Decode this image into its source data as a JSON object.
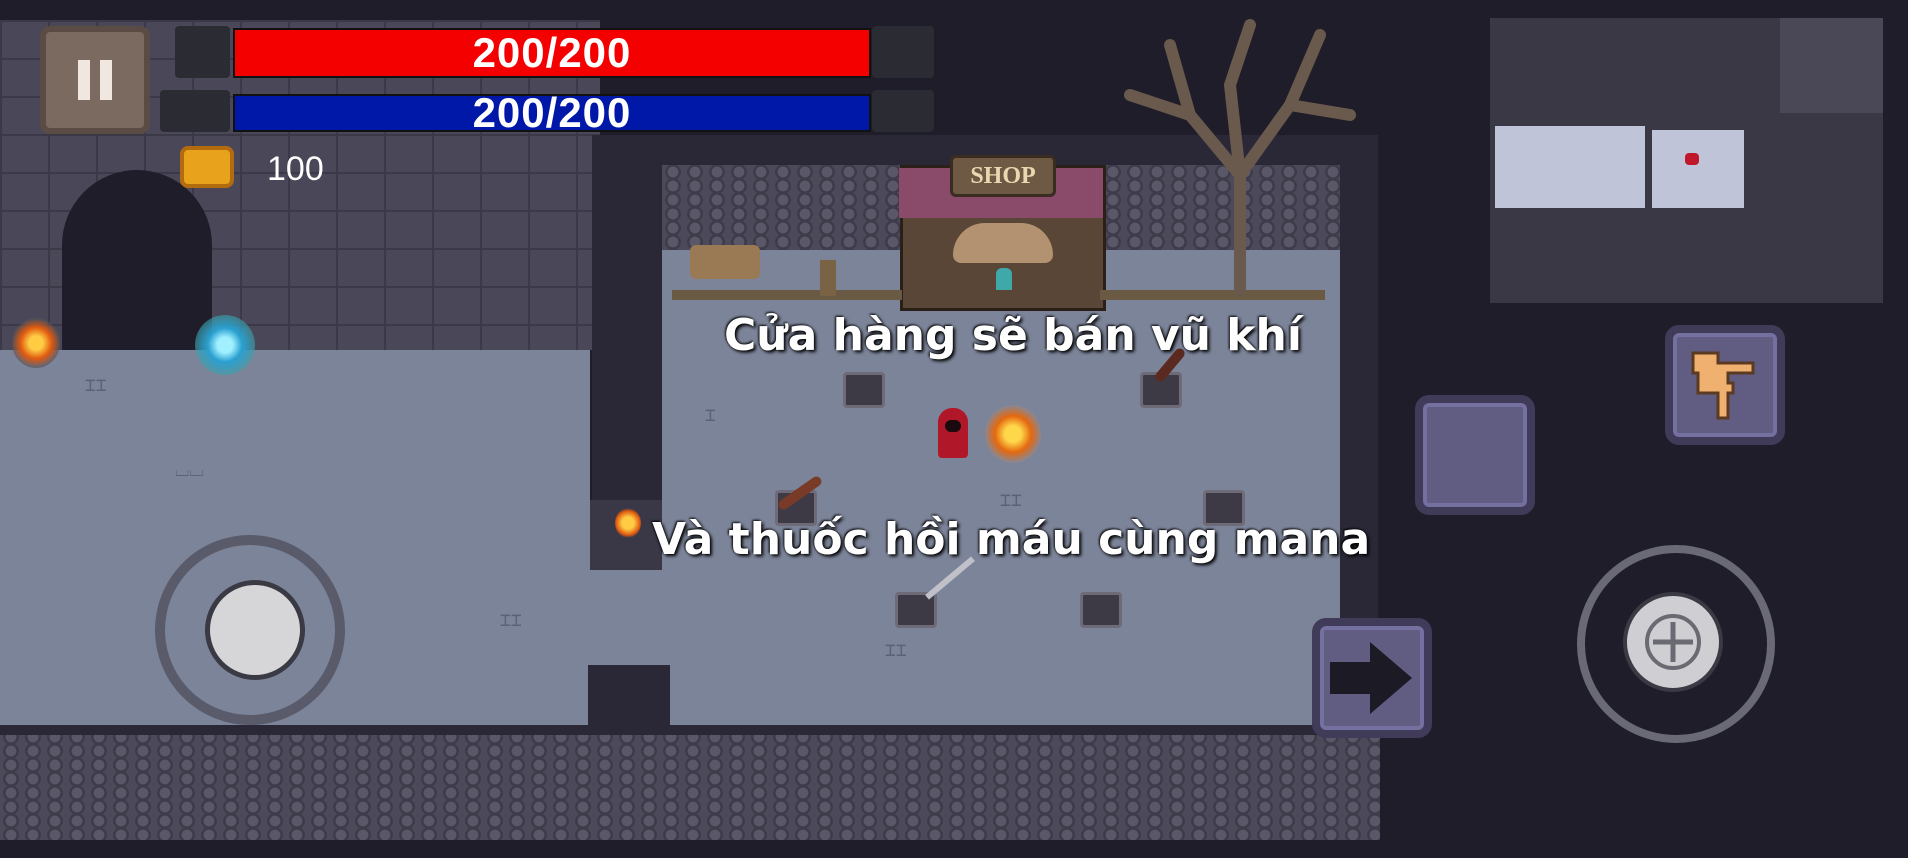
{
  "hud": {
    "hp_text": "200/200",
    "hp_fraction": 1.0,
    "hp_color": "#f40000",
    "mana_text": "200/200",
    "mana_fraction": 1.0,
    "mana_color": "#0018a8",
    "coins": "100"
  },
  "captions": {
    "shop_caption": "Cửa hàng sẽ bán vũ khí",
    "potion_caption": "Và thuốc hồi máu cùng mana"
  },
  "shop_sign": "SHOP",
  "icons": {
    "pause": "pause-icon",
    "coin": "coin-icon",
    "dash": "arrow-right-icon",
    "interact": "hand-point-icon",
    "aim": "crosshair-icon"
  }
}
